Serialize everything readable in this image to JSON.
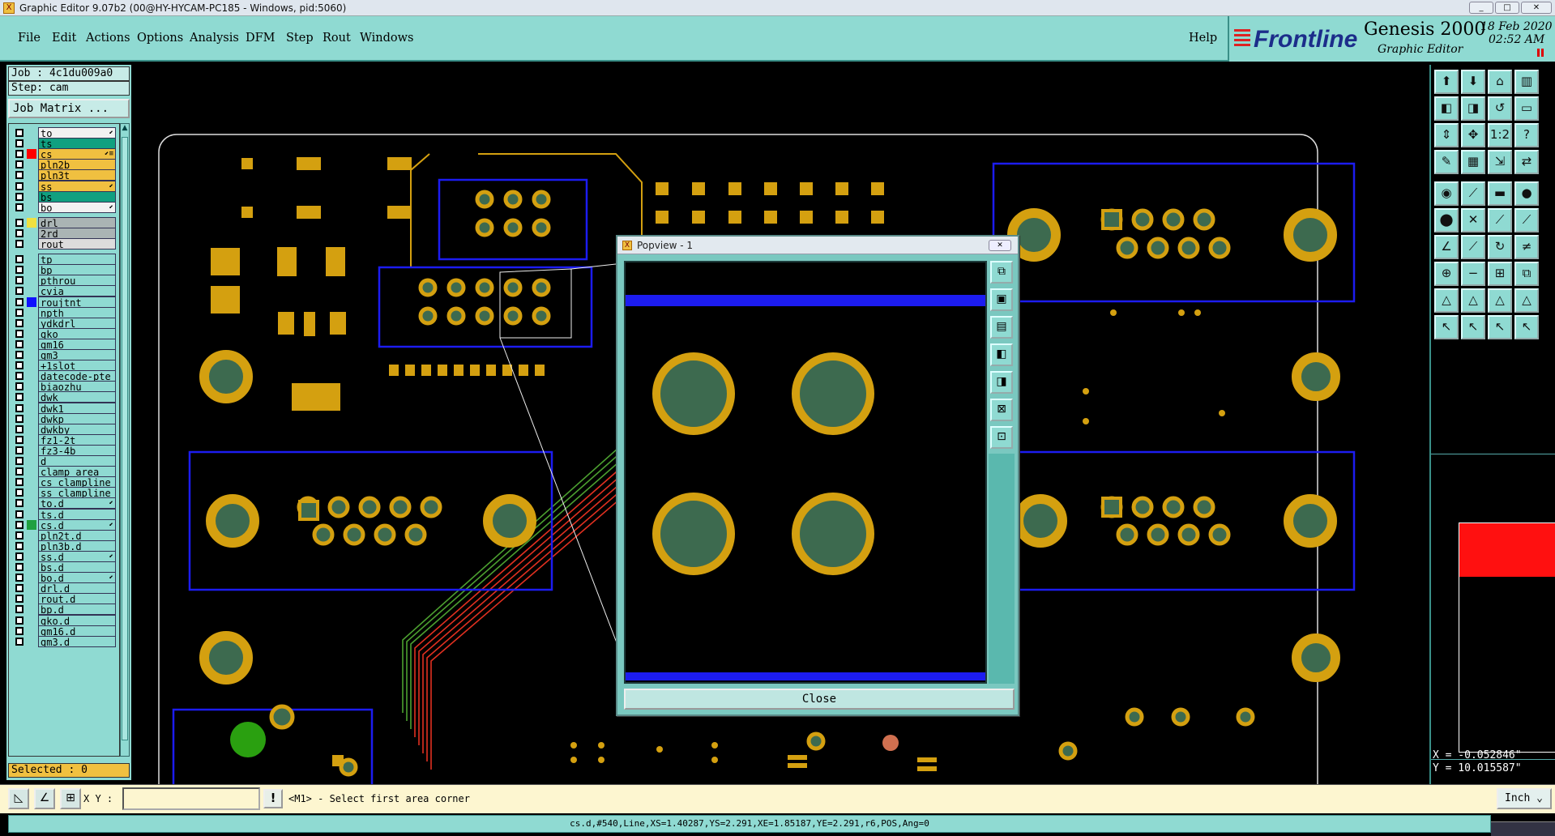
{
  "window": {
    "title": "Graphic Editor 9.07b2 (00@HY-HYCAM-PC185 - Windows, pid:5060)",
    "min": "_",
    "max": "□",
    "close": "✕"
  },
  "menu": {
    "items": [
      "File",
      "Edit",
      "Actions",
      "Options",
      "Analysis",
      "DFM",
      "Step",
      "Rout",
      "Windows"
    ],
    "help": "Help"
  },
  "brand": {
    "logo": "Frontline",
    "product": "Genesis 2000",
    "subtitle": "Graphic Editor",
    "date": "18 Feb 2020",
    "time": "02:52 AM"
  },
  "job": {
    "job_label": "Job : 4c1du009a0",
    "step_label": "Step: cam",
    "matrix_button": "Job Matrix ..."
  },
  "layers": [
    {
      "name": "to",
      "color": "#f2f2f2",
      "mark": "⬋"
    },
    {
      "name": "ts",
      "color": "#10a080",
      "mark": ""
    },
    {
      "name": "cs",
      "color": "#f0c040",
      "mark": "⬋≡",
      "swatch": "#ff0000",
      "checked": true
    },
    {
      "name": "pln2b",
      "color": "#f0c040",
      "mark": ""
    },
    {
      "name": "pln3t",
      "color": "#f0c040",
      "mark": ""
    },
    {
      "name": "ss",
      "color": "#f0c040",
      "mark": "⬋"
    },
    {
      "name": "bs",
      "color": "#10a080",
      "mark": ""
    },
    {
      "name": "bo",
      "color": "#f2f2f2",
      "mark": "⬋"
    },
    {
      "name": "drl",
      "color": "#aab4b4",
      "mark": "",
      "swatch": "#f0e040",
      "gap": true
    },
    {
      "name": "2rd",
      "color": "#aab4b4",
      "mark": ""
    },
    {
      "name": "rout",
      "color": "#dcdcdc",
      "mark": ""
    },
    {
      "name": "tp",
      "color": "#8fdad2",
      "mark": "",
      "gap": true
    },
    {
      "name": "bp",
      "color": "#8fdad2",
      "mark": ""
    },
    {
      "name": "pthrou",
      "color": "#8fdad2",
      "mark": ""
    },
    {
      "name": "cvia",
      "color": "#8fdad2",
      "mark": ""
    },
    {
      "name": "roujtnt",
      "color": "#8fdad2",
      "mark": "",
      "swatch": "#1010ff"
    },
    {
      "name": "npth",
      "color": "#8fdad2",
      "mark": ""
    },
    {
      "name": "ydkdrl",
      "color": "#8fdad2",
      "mark": ""
    },
    {
      "name": "gko",
      "color": "#8fdad2",
      "mark": ""
    },
    {
      "name": "gm16",
      "color": "#8fdad2",
      "mark": ""
    },
    {
      "name": "gm3",
      "color": "#8fdad2",
      "mark": ""
    },
    {
      "name": "+1slot",
      "color": "#8fdad2",
      "mark": ""
    },
    {
      "name": "datecode-pte",
      "color": "#8fdad2",
      "mark": ""
    },
    {
      "name": "biaozhu",
      "color": "#8fdad2",
      "mark": ""
    },
    {
      "name": "dwk",
      "color": "#8fdad2",
      "mark": ""
    },
    {
      "name": "dwk1",
      "color": "#8fdad2",
      "mark": ""
    },
    {
      "name": "dwkp",
      "color": "#8fdad2",
      "mark": ""
    },
    {
      "name": "dwkby",
      "color": "#8fdad2",
      "mark": ""
    },
    {
      "name": "fz1-2t",
      "color": "#8fdad2",
      "mark": ""
    },
    {
      "name": "fz3-4b",
      "color": "#8fdad2",
      "mark": ""
    },
    {
      "name": "d",
      "color": "#8fdad2",
      "mark": ""
    },
    {
      "name": "clamp_area",
      "color": "#8fdad2",
      "mark": ""
    },
    {
      "name": "cs_clampline",
      "color": "#8fdad2",
      "mark": ""
    },
    {
      "name": "ss_clampline",
      "color": "#8fdad2",
      "mark": ""
    },
    {
      "name": "to.d",
      "color": "#8fdad2",
      "mark": "⬋"
    },
    {
      "name": "ts.d",
      "color": "#8fdad2",
      "mark": ""
    },
    {
      "name": "cs.d",
      "color": "#8fdad2",
      "mark": "⬋",
      "swatch": "#20a040"
    },
    {
      "name": "pln2t.d",
      "color": "#8fdad2",
      "mark": ""
    },
    {
      "name": "pln3b.d",
      "color": "#8fdad2",
      "mark": ""
    },
    {
      "name": "ss.d",
      "color": "#8fdad2",
      "mark": "⬋"
    },
    {
      "name": "bs.d",
      "color": "#8fdad2",
      "mark": ""
    },
    {
      "name": "bo.d",
      "color": "#8fdad2",
      "mark": "⬋"
    },
    {
      "name": "drl.d",
      "color": "#8fdad2",
      "mark": ""
    },
    {
      "name": "rout.d",
      "color": "#8fdad2",
      "mark": ""
    },
    {
      "name": "bp.d",
      "color": "#8fdad2",
      "mark": ""
    },
    {
      "name": "gko.d",
      "color": "#8fdad2",
      "mark": ""
    },
    {
      "name": "gm16.d",
      "color": "#8fdad2",
      "mark": ""
    },
    {
      "name": "gm3.d",
      "color": "#8fdad2",
      "mark": ""
    }
  ],
  "selected": "Selected : 0",
  "popview": {
    "title": "Popview - 1",
    "close_label": "Close"
  },
  "coords": {
    "x": "X = -0.052846\"",
    "y": "Y = 10.015587\""
  },
  "command": {
    "xy_label": "X Y :",
    "xy_value": "",
    "warn": "!",
    "prompt": "<M1> - Select first area corner",
    "unit": "Inch ⌄"
  },
  "status": "cs.d,#540,Line,XS=1.40287,YS=2.291,XE=1.85187,YE=2.291,r6,POS,Ang=0",
  "colors": {
    "accent": "#8fdad2",
    "pad": "#d4a010",
    "pad_center": "#3d6a4f",
    "outline": "#1c1cf0",
    "trace_green": "#4ca030",
    "trace_red": "#e03020",
    "selection": "#f0c040"
  },
  "tool_icons": [
    "zoom-home-icon",
    "zoom-in-icon",
    "zoom-fit-icon",
    "window-icon",
    "pan-left-icon",
    "pan-right-icon",
    "redraw-icon",
    "scale-icon",
    "fit-width-icon",
    "fit-all-icon",
    "ruler-icon",
    "help-icon",
    "snap-icon",
    "grid-icon",
    "measure-icon",
    "layer-icon",
    "pad-icon",
    "line-icon",
    "scale-bar-icon",
    "fill-icon",
    "net-icon",
    "cross-icon",
    "arc-icon",
    "link-icon",
    "angle-icon",
    "diag-icon",
    "curve-icon",
    "split-icon",
    "add-icon",
    "minus-icon",
    "move-icon",
    "stack-icon",
    "triangle-icon",
    "triangle2-icon",
    "triangle3-icon",
    "triangle4-icon",
    "select-icon",
    "select2-icon",
    "select3-icon",
    "select4-icon"
  ]
}
